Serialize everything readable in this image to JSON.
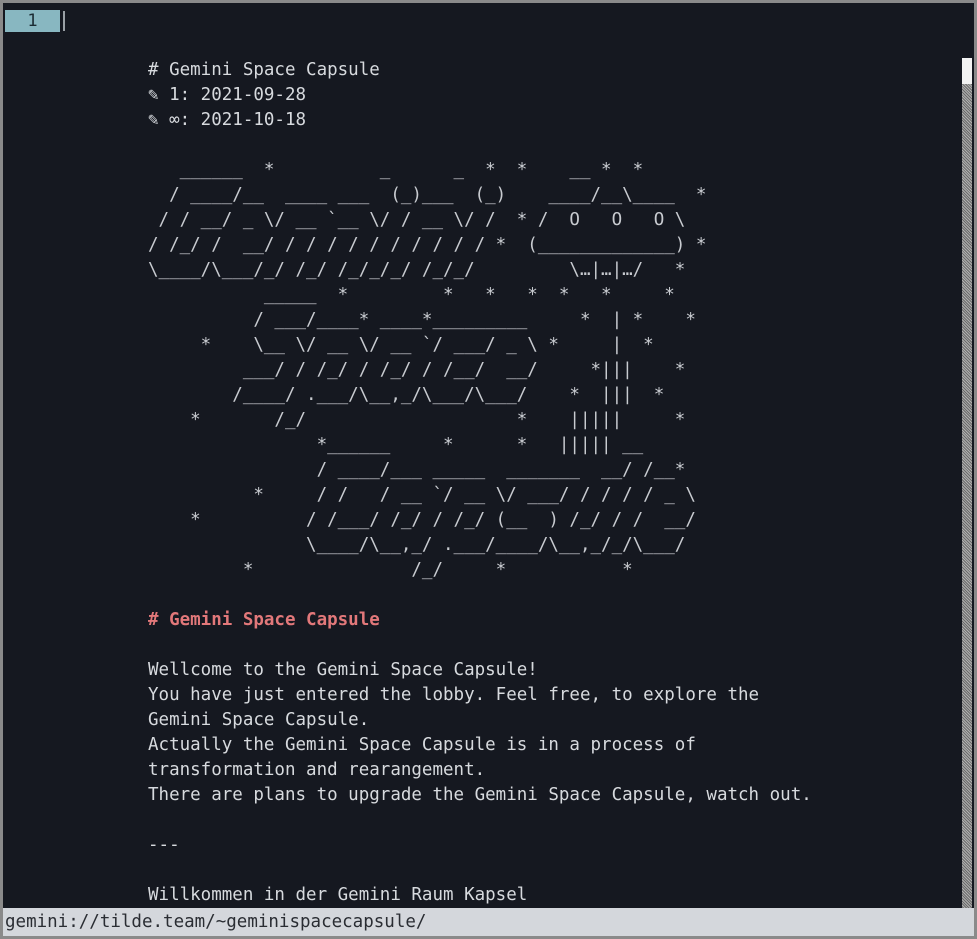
{
  "tabbar": {
    "tabs": [
      {
        "label": "1"
      }
    ]
  },
  "document": {
    "lines": [
      "# Gemini Space Capsule",
      "✎ 1: 2021-09-28",
      "✎ ∞: 2021-10-18",
      "",
      "   ______  *          _      _  *  *    __ *  *",
      "  / ____/__  ____ ___  (_)___  (_)    ____/__\\____  *",
      " / / __/ _ \\/ __ `__ \\/ / __ \\/ /  * /  O   O   O \\",
      "/ /_/ /  __/ / / / / / / / / / / *  (_____________) *",
      "\\____/\\___/_/ /_/ /_/_/_/ /_/_/         \\…|…|…/   *",
      "           _____  *         *   *   *  *   *     *",
      "          / ___/____* ____*_________     *  | *    *",
      "     *    \\__ \\/ __ \\/ __ `/ ___/ _ \\ *     |  *",
      "         ___/ / /_/ / /_/ / /__/  __/     *|||    *",
      "        /____/ .___/\\__,_/\\___/\\___/    *  |||  *",
      "    *       /_/                    *    |||||     *",
      "                *______     *      *   ||||| __",
      "                / ____/___ _____  _______  __/ /__*",
      "          *     / /   / __ `/ __ \\/ ___/ / / / / _ \\",
      "    *          / /___/ /_/ / /_/ (__  ) /_/ / /  __/",
      "               \\____/\\__,_/ .___/____/\\__,_/_/\\___/",
      "         *               /_/     *           *",
      "",
      "# Gemini Space Capsule",
      "",
      "Wellcome to the Gemini Space Capsule!",
      "You have just entered the lobby. Feel free, to explore the",
      "Gemini Space Capsule.",
      "Actually the Gemini Space Capsule is in a process of",
      "transformation and rearangement.",
      "There are plans to upgrade the Gemini Space Capsule, watch out.",
      "",
      "---",
      "",
      "Willkommen in der Gemini Raum Kapsel"
    ]
  },
  "statusbar": {
    "url": "gemini://tilde.team/~geminispacecapsule/"
  }
}
